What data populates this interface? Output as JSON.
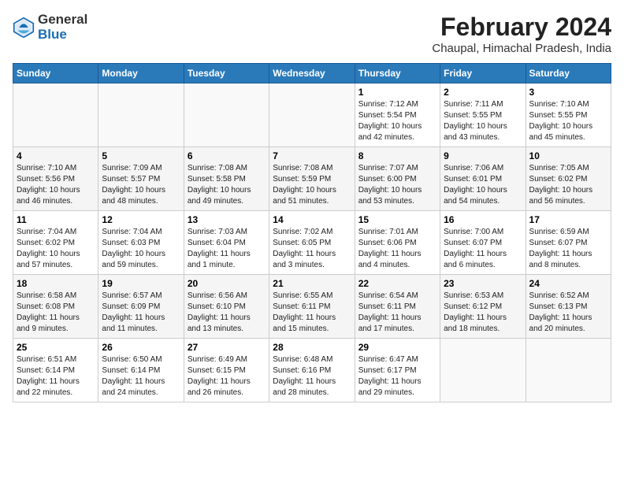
{
  "logo": {
    "text1": "General",
    "text2": "Blue"
  },
  "header": {
    "month_year": "February 2024",
    "location": "Chaupal, Himachal Pradesh, India"
  },
  "weekdays": [
    "Sunday",
    "Monday",
    "Tuesday",
    "Wednesday",
    "Thursday",
    "Friday",
    "Saturday"
  ],
  "weeks": [
    [
      {
        "day": "",
        "info": ""
      },
      {
        "day": "",
        "info": ""
      },
      {
        "day": "",
        "info": ""
      },
      {
        "day": "",
        "info": ""
      },
      {
        "day": "1",
        "info": "Sunrise: 7:12 AM\nSunset: 5:54 PM\nDaylight: 10 hours\nand 42 minutes."
      },
      {
        "day": "2",
        "info": "Sunrise: 7:11 AM\nSunset: 5:55 PM\nDaylight: 10 hours\nand 43 minutes."
      },
      {
        "day": "3",
        "info": "Sunrise: 7:10 AM\nSunset: 5:55 PM\nDaylight: 10 hours\nand 45 minutes."
      }
    ],
    [
      {
        "day": "4",
        "info": "Sunrise: 7:10 AM\nSunset: 5:56 PM\nDaylight: 10 hours\nand 46 minutes."
      },
      {
        "day": "5",
        "info": "Sunrise: 7:09 AM\nSunset: 5:57 PM\nDaylight: 10 hours\nand 48 minutes."
      },
      {
        "day": "6",
        "info": "Sunrise: 7:08 AM\nSunset: 5:58 PM\nDaylight: 10 hours\nand 49 minutes."
      },
      {
        "day": "7",
        "info": "Sunrise: 7:08 AM\nSunset: 5:59 PM\nDaylight: 10 hours\nand 51 minutes."
      },
      {
        "day": "8",
        "info": "Sunrise: 7:07 AM\nSunset: 6:00 PM\nDaylight: 10 hours\nand 53 minutes."
      },
      {
        "day": "9",
        "info": "Sunrise: 7:06 AM\nSunset: 6:01 PM\nDaylight: 10 hours\nand 54 minutes."
      },
      {
        "day": "10",
        "info": "Sunrise: 7:05 AM\nSunset: 6:02 PM\nDaylight: 10 hours\nand 56 minutes."
      }
    ],
    [
      {
        "day": "11",
        "info": "Sunrise: 7:04 AM\nSunset: 6:02 PM\nDaylight: 10 hours\nand 57 minutes."
      },
      {
        "day": "12",
        "info": "Sunrise: 7:04 AM\nSunset: 6:03 PM\nDaylight: 10 hours\nand 59 minutes."
      },
      {
        "day": "13",
        "info": "Sunrise: 7:03 AM\nSunset: 6:04 PM\nDaylight: 11 hours\nand 1 minute."
      },
      {
        "day": "14",
        "info": "Sunrise: 7:02 AM\nSunset: 6:05 PM\nDaylight: 11 hours\nand 3 minutes."
      },
      {
        "day": "15",
        "info": "Sunrise: 7:01 AM\nSunset: 6:06 PM\nDaylight: 11 hours\nand 4 minutes."
      },
      {
        "day": "16",
        "info": "Sunrise: 7:00 AM\nSunset: 6:07 PM\nDaylight: 11 hours\nand 6 minutes."
      },
      {
        "day": "17",
        "info": "Sunrise: 6:59 AM\nSunset: 6:07 PM\nDaylight: 11 hours\nand 8 minutes."
      }
    ],
    [
      {
        "day": "18",
        "info": "Sunrise: 6:58 AM\nSunset: 6:08 PM\nDaylight: 11 hours\nand 9 minutes."
      },
      {
        "day": "19",
        "info": "Sunrise: 6:57 AM\nSunset: 6:09 PM\nDaylight: 11 hours\nand 11 minutes."
      },
      {
        "day": "20",
        "info": "Sunrise: 6:56 AM\nSunset: 6:10 PM\nDaylight: 11 hours\nand 13 minutes."
      },
      {
        "day": "21",
        "info": "Sunrise: 6:55 AM\nSunset: 6:11 PM\nDaylight: 11 hours\nand 15 minutes."
      },
      {
        "day": "22",
        "info": "Sunrise: 6:54 AM\nSunset: 6:11 PM\nDaylight: 11 hours\nand 17 minutes."
      },
      {
        "day": "23",
        "info": "Sunrise: 6:53 AM\nSunset: 6:12 PM\nDaylight: 11 hours\nand 18 minutes."
      },
      {
        "day": "24",
        "info": "Sunrise: 6:52 AM\nSunset: 6:13 PM\nDaylight: 11 hours\nand 20 minutes."
      }
    ],
    [
      {
        "day": "25",
        "info": "Sunrise: 6:51 AM\nSunset: 6:14 PM\nDaylight: 11 hours\nand 22 minutes."
      },
      {
        "day": "26",
        "info": "Sunrise: 6:50 AM\nSunset: 6:14 PM\nDaylight: 11 hours\nand 24 minutes."
      },
      {
        "day": "27",
        "info": "Sunrise: 6:49 AM\nSunset: 6:15 PM\nDaylight: 11 hours\nand 26 minutes."
      },
      {
        "day": "28",
        "info": "Sunrise: 6:48 AM\nSunset: 6:16 PM\nDaylight: 11 hours\nand 28 minutes."
      },
      {
        "day": "29",
        "info": "Sunrise: 6:47 AM\nSunset: 6:17 PM\nDaylight: 11 hours\nand 29 minutes."
      },
      {
        "day": "",
        "info": ""
      },
      {
        "day": "",
        "info": ""
      }
    ]
  ]
}
